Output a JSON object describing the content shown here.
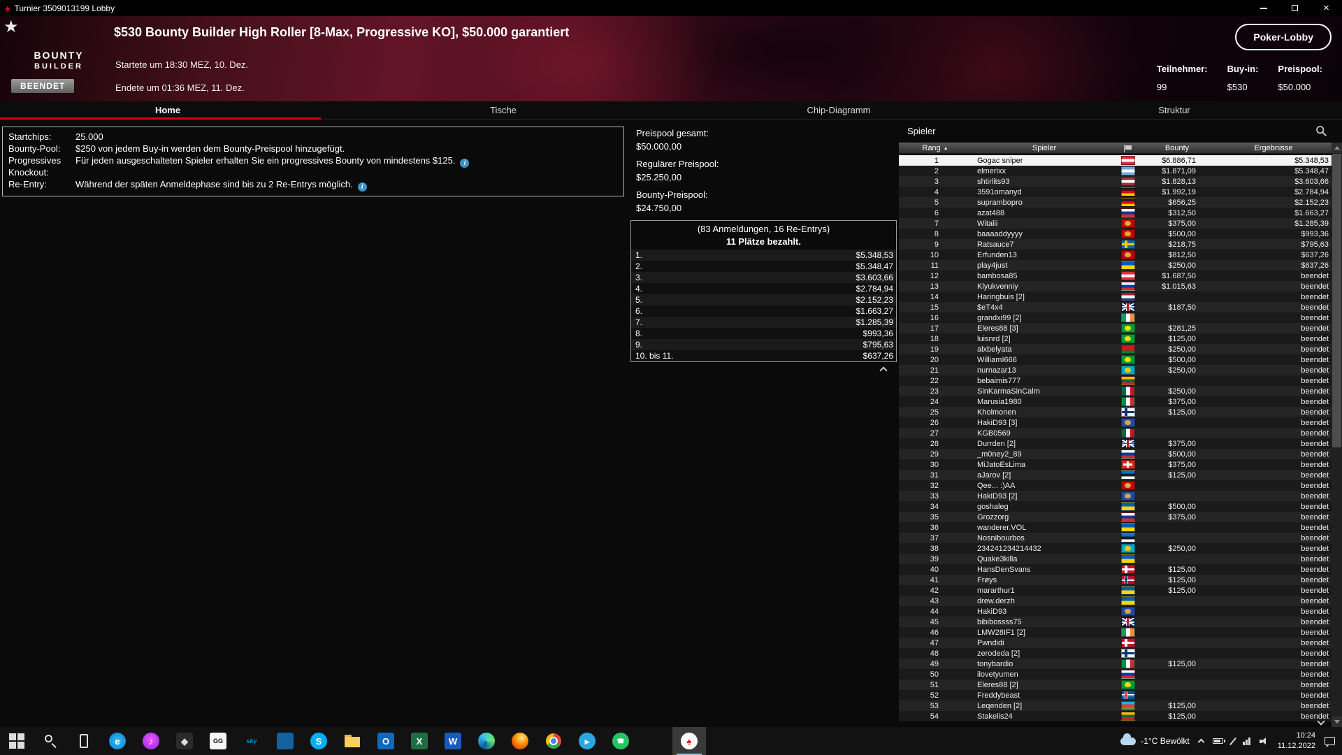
{
  "titlebar": {
    "title": "Turnier 3509013199 Lobby"
  },
  "header": {
    "logo": {
      "line1": "BOUNTY",
      "line2": "BUILDER"
    },
    "title": "$530 Bounty Builder High Roller [8-Max, Progressive KO], $50.000 garantiert",
    "started": "Startete um 18:30 MEZ, 10. Dez.",
    "ended": "Endete um 01:36 MEZ, 11. Dez.",
    "status_badge": "BEENDET",
    "lobby_button": "Poker-Lobby",
    "stats": [
      {
        "label": "Teilnehmer:",
        "value": "99"
      },
      {
        "label": "Buy-in:",
        "value": "$530"
      },
      {
        "label": "Preispool:",
        "value": "$50.000"
      }
    ],
    "accent_red": "#d6001c"
  },
  "tabs": [
    {
      "label": "Home",
      "active": true
    },
    {
      "label": "Tische",
      "active": false
    },
    {
      "label": "Chip-Diagramm",
      "active": false
    },
    {
      "label": "Struktur",
      "active": false
    }
  ],
  "info_panel": {
    "rows": [
      {
        "label": "Startchips:",
        "text": "25.000",
        "info": false
      },
      {
        "label": "Bounty-Pool:",
        "text": "$250 von jedem Buy-in werden dem Bounty-Preispool hinzugefügt.",
        "info": false
      },
      {
        "label": "Progressives Knockout:",
        "text": "Für jeden ausgeschalteten Spieler erhalten Sie ein progressives Bounty von mindestens $125.",
        "info": true
      },
      {
        "label": "Re-Entry:",
        "text": "Während der späten Anmeldephase sind bis zu 2 Re-Entrys möglich.",
        "info": true
      }
    ]
  },
  "prize_panel": {
    "pools": [
      {
        "label": "Preispool gesamt:",
        "value": "$50.000,00"
      },
      {
        "label": "Regulärer Preispool:",
        "value": "$25.250,00"
      },
      {
        "label": "Bounty-Preispool:",
        "value": "$24.750,00"
      }
    ],
    "entries_line": "(83 Anmeldungen, 16 Re-Entrys)",
    "paid_line": "11 Plätze bezahlt.",
    "payouts": [
      {
        "place": "1.",
        "amount": "$5.348,53"
      },
      {
        "place": "2.",
        "amount": "$5.348,47"
      },
      {
        "place": "3.",
        "amount": "$3.603,66"
      },
      {
        "place": "4.",
        "amount": "$2.784,94"
      },
      {
        "place": "5.",
        "amount": "$2.152,23"
      },
      {
        "place": "6.",
        "amount": "$1.663,27"
      },
      {
        "place": "7.",
        "amount": "$1.285,39"
      },
      {
        "place": "8.",
        "amount": "$993,36"
      },
      {
        "place": "9.",
        "amount": "$795,63"
      },
      {
        "place": "10. bis 11.",
        "amount": "$637,26"
      }
    ]
  },
  "players_panel": {
    "title": "Spieler",
    "columns": {
      "rank": "Rang",
      "player": "Spieler",
      "bounty": "Bounty",
      "result": "Ergebnisse"
    },
    "rows": [
      {
        "rank": 1,
        "name": "Gogac sniper",
        "flag": "at",
        "bounty": "$6.886,71",
        "result": "$5.348,53",
        "selected": true
      },
      {
        "rank": 2,
        "name": "elmerixx",
        "flag": "ar",
        "bounty": "$1.871,09",
        "result": "$5.348,47"
      },
      {
        "rank": 3,
        "name": "shtirlits93",
        "flag": "lv",
        "bounty": "$1.828,13",
        "result": "$3.603,66"
      },
      {
        "rank": 4,
        "name": "3591omanyd",
        "flag": "de",
        "bounty": "$1.992,19",
        "result": "$2.784,94"
      },
      {
        "rank": 5,
        "name": "suprambopro",
        "flag": "de",
        "bounty": "$656,25",
        "result": "$2.152,23"
      },
      {
        "rank": 6,
        "name": "azat488",
        "flag": "ru",
        "bounty": "$312,50",
        "result": "$1.663,27"
      },
      {
        "rank": 7,
        "name": "Witalii",
        "flag": "me",
        "bounty": "$375,00",
        "result": "$1.285,39"
      },
      {
        "rank": 8,
        "name": "baaaaddyyyy",
        "flag": "me",
        "bounty": "$500,00",
        "result": "$993,36"
      },
      {
        "rank": 9,
        "name": "Ratsauce7",
        "flag": "se",
        "bounty": "$218,75",
        "result": "$795,63"
      },
      {
        "rank": 10,
        "name": "Erfunden13",
        "flag": "me",
        "bounty": "$812,50",
        "result": "$637,26"
      },
      {
        "rank": 11,
        "name": "play4just",
        "flag": "ua",
        "bounty": "$250,00",
        "result": "$637,26"
      },
      {
        "rank": 12,
        "name": "bambosa85",
        "flag": "at",
        "bounty": "$1.687,50",
        "result": "beendet"
      },
      {
        "rank": 13,
        "name": "Klyukvenniy",
        "flag": "ru",
        "bounty": "$1.015,63",
        "result": "beendet"
      },
      {
        "rank": 14,
        "name": "Haringbuis [2]",
        "flag": "nl",
        "bounty": "",
        "result": "beendet"
      },
      {
        "rank": 15,
        "name": "$eT4x4",
        "flag": "gb",
        "bounty": "$187,50",
        "result": "beendet"
      },
      {
        "rank": 16,
        "name": "grandxi99 [2]",
        "flag": "ie",
        "bounty": "",
        "result": "beendet"
      },
      {
        "rank": 17,
        "name": "Eleres88 [3]",
        "flag": "br",
        "bounty": "$281,25",
        "result": "beendet"
      },
      {
        "rank": 18,
        "name": "luisnrd [2]",
        "flag": "br",
        "bounty": "$125,00",
        "result": "beendet"
      },
      {
        "rank": 19,
        "name": "alxbelyata",
        "flag": "by",
        "bounty": "$250,00",
        "result": "beendet"
      },
      {
        "rank": 20,
        "name": "WilliamI666",
        "flag": "br",
        "bounty": "$500,00",
        "result": "beendet"
      },
      {
        "rank": 21,
        "name": "nurnazar13",
        "flag": "kz",
        "bounty": "$250,00",
        "result": "beendet"
      },
      {
        "rank": 22,
        "name": "bebaimis777",
        "flag": "lt",
        "bounty": "",
        "result": "beendet"
      },
      {
        "rank": 23,
        "name": "SinKarmaSinCalm",
        "flag": "mx",
        "bounty": "$250,00",
        "result": "beendet"
      },
      {
        "rank": 24,
        "name": "Marusia1980",
        "flag": "it",
        "bounty": "$375,00",
        "result": "beendet"
      },
      {
        "rank": 25,
        "name": "Kholmonen",
        "flag": "fi",
        "bounty": "$125,00",
        "result": "beendet"
      },
      {
        "rank": 26,
        "name": "HakiD93 [3]",
        "flag": "xk",
        "bounty": "",
        "result": "beendet"
      },
      {
        "rank": 27,
        "name": "KGB0569",
        "flag": "mx",
        "bounty": "",
        "result": "beendet"
      },
      {
        "rank": 28,
        "name": "Durrden [2]",
        "flag": "gb",
        "bounty": "$375,00",
        "result": "beendet"
      },
      {
        "rank": 29,
        "name": "_m0ney2_89",
        "flag": "ru",
        "bounty": "$500,00",
        "result": "beendet"
      },
      {
        "rank": 30,
        "name": "MiJatoEsLima",
        "flag": "ch",
        "bounty": "$375,00",
        "result": "beendet"
      },
      {
        "rank": 31,
        "name": "aJarov [2]",
        "flag": "ee",
        "bounty": "$125,00",
        "result": "beendet"
      },
      {
        "rank": 32,
        "name": "Qee... :)AA",
        "flag": "me",
        "bounty": "",
        "result": "beendet"
      },
      {
        "rank": 33,
        "name": "HakiD93 [2]",
        "flag": "xk",
        "bounty": "",
        "result": "beendet"
      },
      {
        "rank": 34,
        "name": "goshaleg",
        "flag": "ua",
        "bounty": "$500,00",
        "result": "beendet"
      },
      {
        "rank": 35,
        "name": "Grozzorg",
        "flag": "ru",
        "bounty": "$375,00",
        "result": "beendet"
      },
      {
        "rank": 36,
        "name": "wanderer.VOL",
        "flag": "ua",
        "bounty": "",
        "result": "beendet"
      },
      {
        "rank": 37,
        "name": "Nosnibourbos",
        "flag": "ee",
        "bounty": "",
        "result": "beendet"
      },
      {
        "rank": 38,
        "name": "234241234214432",
        "flag": "kz",
        "bounty": "$250,00",
        "result": "beendet"
      },
      {
        "rank": 39,
        "name": "Quake3killa",
        "flag": "ua",
        "bounty": "",
        "result": "beendet"
      },
      {
        "rank": 40,
        "name": "HansDenSvans",
        "flag": "dk",
        "bounty": "$125,00",
        "result": "beendet"
      },
      {
        "rank": 41,
        "name": "Frøys",
        "flag": "no",
        "bounty": "$125,00",
        "result": "beendet"
      },
      {
        "rank": 42,
        "name": "mararthur1",
        "flag": "ua",
        "bounty": "$125,00",
        "result": "beendet"
      },
      {
        "rank": 43,
        "name": "drew.derzh",
        "flag": "ua",
        "bounty": "",
        "result": "beendet"
      },
      {
        "rank": 44,
        "name": "HakiD93",
        "flag": "xk",
        "bounty": "",
        "result": "beendet"
      },
      {
        "rank": 45,
        "name": "bibibossss75",
        "flag": "gb",
        "bounty": "",
        "result": "beendet"
      },
      {
        "rank": 46,
        "name": "LMW28IF1 [2]",
        "flag": "ie",
        "bounty": "",
        "result": "beendet"
      },
      {
        "rank": 47,
        "name": "Pwndidi",
        "flag": "dk",
        "bounty": "",
        "result": "beendet"
      },
      {
        "rank": 48,
        "name": "zerodeda [2]",
        "flag": "fi",
        "bounty": "",
        "result": "beendet"
      },
      {
        "rank": 49,
        "name": "tonybardio",
        "flag": "it",
        "bounty": "$125,00",
        "result": "beendet"
      },
      {
        "rank": 50,
        "name": "ilovetyumen",
        "flag": "ru",
        "bounty": "",
        "result": "beendet"
      },
      {
        "rank": 51,
        "name": "Eleres88 [2]",
        "flag": "br",
        "bounty": "",
        "result": "beendet"
      },
      {
        "rank": 52,
        "name": "Freddybeast",
        "flag": "is",
        "bounty": "",
        "result": "beendet"
      },
      {
        "rank": 53,
        "name": "Leqenden [2]",
        "flag": "az",
        "bounty": "$125,00",
        "result": "beendet"
      },
      {
        "rank": 54,
        "name": "Stakelis24",
        "flag": "lt",
        "bounty": "$125,00",
        "result": "beendet"
      }
    ]
  },
  "flags": {
    "at": {
      "type": "h",
      "colors": [
        "#ED2939",
        "#FFFFFF",
        "#ED2939"
      ]
    },
    "ar": {
      "type": "h",
      "colors": [
        "#74ACDF",
        "#FFFFFF",
        "#74ACDF"
      ]
    },
    "lv": {
      "type": "h",
      "colors": [
        "#9E3039",
        "#FFFFFF",
        "#9E3039"
      ]
    },
    "de": {
      "type": "h",
      "colors": [
        "#1A1A1A",
        "#DD0000",
        "#FFCE00"
      ]
    },
    "ru": {
      "type": "h",
      "colors": [
        "#FFFFFF",
        "#0039A6",
        "#D52B1E"
      ]
    },
    "ua": {
      "type": "h",
      "colors": [
        "#005BBB",
        "#FFD500"
      ]
    },
    "nl": {
      "type": "h",
      "colors": [
        "#AE1C28",
        "#FFFFFF",
        "#21468B"
      ]
    },
    "ee": {
      "type": "h",
      "colors": [
        "#0072CE",
        "#1A1A1A",
        "#FFFFFF"
      ]
    },
    "lt": {
      "type": "h",
      "colors": [
        "#FDB913",
        "#006A44",
        "#C1272D"
      ]
    },
    "by": {
      "type": "h",
      "colors": [
        "#CE1720",
        "#CE1720",
        "#007C30"
      ]
    },
    "az": {
      "type": "h",
      "colors": [
        "#00B9E4",
        "#EF3340",
        "#509E2F"
      ]
    },
    "ie": {
      "type": "v",
      "colors": [
        "#169B62",
        "#FFFFFF",
        "#FF883E"
      ]
    },
    "it": {
      "type": "v",
      "colors": [
        "#009246",
        "#FFFFFF",
        "#CE2B37"
      ]
    },
    "mx": {
      "type": "v",
      "colors": [
        "#006847",
        "#FFFFFF",
        "#CE1126"
      ]
    },
    "se": {
      "type": "cross",
      "bg": "#006AA7",
      "cross": "#FECC00"
    },
    "fi": {
      "type": "cross",
      "bg": "#F5F5F5",
      "cross": "#003580"
    },
    "dk": {
      "type": "cross",
      "bg": "#C8102E",
      "cross": "#FFFFFF"
    },
    "no": {
      "type": "cross",
      "bg": "#BA0C2F",
      "cross": "#FFFFFF",
      "inner": "#00205B"
    },
    "is": {
      "type": "cross",
      "bg": "#02529C",
      "cross": "#FFFFFF",
      "inner": "#DC1E35"
    },
    "ch": {
      "type": "plus",
      "bg": "#D52B1E",
      "cross": "#FFFFFF"
    },
    "gb": {
      "type": "uk",
      "colors": [
        "#012169",
        "#FFFFFF",
        "#C8102C"
      ]
    },
    "me": {
      "type": "emblem",
      "bg": "#C40308",
      "dot": "#D3AE3B"
    },
    "xk": {
      "type": "emblem",
      "bg": "#244AA5",
      "dot": "#D0A650"
    },
    "br": {
      "type": "emblem",
      "bg": "#009C3B",
      "dot": "#FEDF00"
    },
    "kz": {
      "type": "emblem",
      "bg": "#00ABC2",
      "dot": "#FEC50C"
    }
  },
  "taskbar": {
    "apps": [
      {
        "name": "start-button",
        "type": "win"
      },
      {
        "name": "search-button",
        "type": "search"
      },
      {
        "name": "your-phone-app",
        "type": "phone"
      },
      {
        "name": "edge-legacy-app",
        "glyph": "e",
        "bg": "radial-gradient(circle,#35c1f1,#0b7bd4)",
        "fg": "#ffffff",
        "radius": "50%"
      },
      {
        "name": "itunes-app",
        "glyph": "♪",
        "bg": "radial-gradient(circle at 50% 40%,#f452ff,#8a2be2)",
        "fg": "#ffffff",
        "radius": "50%"
      },
      {
        "name": "dark-diamond-app",
        "glyph": "◆",
        "bg": "#2b2b2b",
        "fg": "#dddddd",
        "radius": "4px"
      },
      {
        "name": "ggpoker-app",
        "glyph": "GG",
        "bg": "#f5f5f5",
        "fg": "#111111",
        "radius": "3px",
        "small": true
      },
      {
        "name": "sky-app",
        "glyph": "sky",
        "bg": "none",
        "fg": "#0098d8",
        "italic": true,
        "small": true
      },
      {
        "name": "blue-app",
        "glyph": "",
        "bg": "#1261a0",
        "fg": "#ffffff",
        "radius": "3px"
      },
      {
        "name": "skype-app",
        "glyph": "S",
        "bg": "#00aff0",
        "fg": "#ffffff",
        "radius": "50%"
      },
      {
        "name": "file-explorer",
        "type": "folder"
      },
      {
        "name": "outlook-app",
        "glyph": "O",
        "bg": "#1169bc",
        "fg": "#ffffff",
        "radius": "3px"
      },
      {
        "name": "excel-app",
        "glyph": "X",
        "bg": "#1d6f42",
        "fg": "#ffffff",
        "radius": "3px"
      },
      {
        "name": "word-app",
        "glyph": "W",
        "bg": "#185abd",
        "fg": "#ffffff",
        "radius": "3px"
      },
      {
        "name": "edge-app",
        "glyph": "",
        "bg": "conic-gradient(from 200deg,#0c59a4,#35c1f1,#66eb6e,#0c59a4)",
        "radius": "50%"
      },
      {
        "name": "firefox-app",
        "glyph": "",
        "bg": "radial-gradient(circle at 60% 30%,#ffe98a,#ff9500 40%,#e4550e 70%,#9e2f12)",
        "radius": "50%"
      },
      {
        "name": "chrome-app",
        "type": "chrome"
      },
      {
        "name": "telegram-app",
        "glyph": "▸",
        "bg": "#2aa7de",
        "fg": "#ffffff",
        "radius": "50%"
      },
      {
        "name": "whatsapp-app",
        "glyph": "☎",
        "bg": "#23c463",
        "fg": "#ffffff",
        "radius": "50%",
        "small": true
      },
      {
        "name": "pokerstars-app",
        "glyph": "♠",
        "bg": "#ffffff",
        "fg": "#e2001a",
        "radius": "50%",
        "active": true
      }
    ],
    "tray": {
      "weather": "-1°C Bewölkt",
      "time": "10:24",
      "date": "11.12.2022"
    }
  }
}
